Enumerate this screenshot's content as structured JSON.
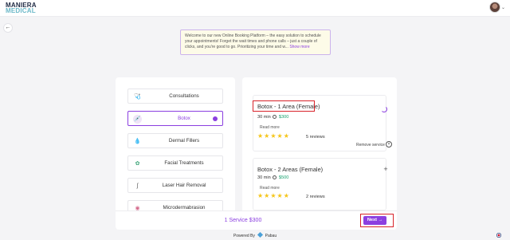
{
  "brand": {
    "line1": "MANIERA",
    "line2": "MEDICAL"
  },
  "header": {
    "avatar_icon": "user-avatar",
    "chevron": "⌄"
  },
  "nav": {
    "back_icon": "←"
  },
  "notice": {
    "text": "Welcome to our new Online Booking Platform – the easy solution to schedule your appointments! Forget the wait times and phone calls – just a couple of clicks, and you're good to go. Prioritizing your time and w...",
    "show_more": "Show more"
  },
  "categories": [
    {
      "label": "Consultations",
      "icon": "🩺",
      "active": false
    },
    {
      "label": "Botox",
      "icon": "💉",
      "active": true
    },
    {
      "label": "Dermal Fillers",
      "icon": "💧",
      "active": false
    },
    {
      "label": "Facial Treatments",
      "icon": "✿",
      "active": false
    },
    {
      "label": "Laser Hair Removal",
      "icon": "ʃ",
      "active": false
    },
    {
      "label": "Microdermabrasion",
      "icon": "◉",
      "active": false
    }
  ],
  "services": [
    {
      "title": "Botox - 1 Area (Female)",
      "duration": "30 min",
      "price": "$300",
      "read_more": "Read more",
      "stars": "★★★★★",
      "reviews": "5 reviews",
      "remove_label": "Remove service",
      "remove_icon": "×",
      "selected": true
    },
    {
      "title": "Botox - 2 Areas (Female)",
      "duration": "30 min",
      "price": "$500",
      "read_more": "Read more",
      "stars": "★★★★★",
      "reviews": "2 reviews",
      "add_icon": "+",
      "selected": false
    }
  ],
  "footer": {
    "summary": "1 Service $300",
    "next_label": "Next",
    "next_arrow": "→",
    "powered_prefix": "Powered By",
    "powered_brand": "Pabau"
  },
  "colors": {
    "accent": "#8b3fe0",
    "price": "#1aa370",
    "star": "#f5c518",
    "highlight": "#d8232a"
  }
}
